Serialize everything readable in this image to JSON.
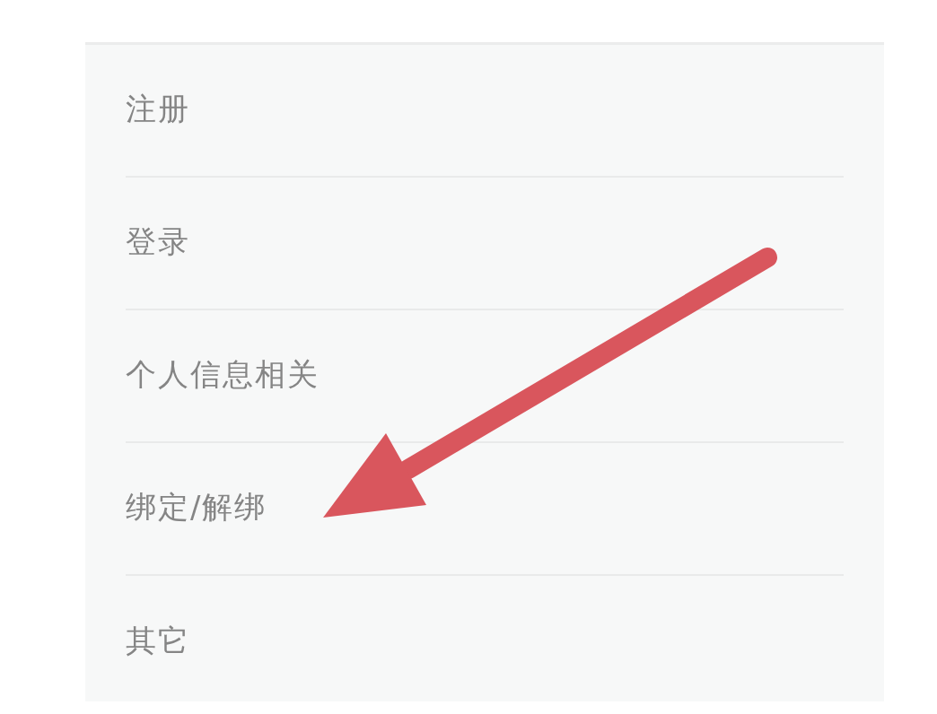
{
  "menu": {
    "items": [
      {
        "label": "注册"
      },
      {
        "label": "登录"
      },
      {
        "label": "个人信息相关"
      },
      {
        "label": "绑定/解绑"
      },
      {
        "label": "其它"
      }
    ]
  }
}
